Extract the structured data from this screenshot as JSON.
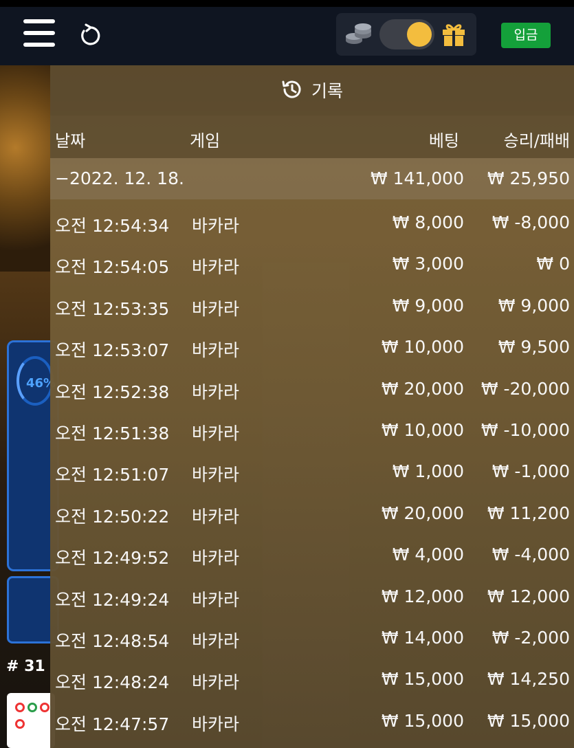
{
  "topbar": {
    "deposit_label": "입금"
  },
  "background": {
    "percent_label": "46%",
    "round_label": "# 31"
  },
  "history": {
    "title": "기록",
    "columns": {
      "date": "날짜",
      "game": "게임",
      "bet": "베팅",
      "result": "승리/패배"
    },
    "day": {
      "date": "−2022. 12. 18.",
      "bet_total": "₩ 141,000",
      "result_total": "₩ 25,950"
    },
    "rows": [
      {
        "time": "오전 12:54:34",
        "game": "바카라",
        "bet": "₩ 8,000",
        "result": "₩ -8,000"
      },
      {
        "time": "오전 12:54:05",
        "game": "바카라",
        "bet": "₩ 3,000",
        "result": "₩ 0"
      },
      {
        "time": "오전 12:53:35",
        "game": "바카라",
        "bet": "₩ 9,000",
        "result": "₩ 9,000"
      },
      {
        "time": "오전 12:53:07",
        "game": "바카라",
        "bet": "₩ 10,000",
        "result": "₩ 9,500"
      },
      {
        "time": "오전 12:52:38",
        "game": "바카라",
        "bet": "₩ 20,000",
        "result": "₩ -20,000"
      },
      {
        "time": "오전 12:51:38",
        "game": "바카라",
        "bet": "₩ 10,000",
        "result": "₩ -10,000"
      },
      {
        "time": "오전 12:51:07",
        "game": "바카라",
        "bet": "₩ 1,000",
        "result": "₩ -1,000"
      },
      {
        "time": "오전 12:50:22",
        "game": "바카라",
        "bet": "₩ 20,000",
        "result": "₩ 11,200"
      },
      {
        "time": "오전 12:49:52",
        "game": "바카라",
        "bet": "₩ 4,000",
        "result": "₩ -4,000"
      },
      {
        "time": "오전 12:49:24",
        "game": "바카라",
        "bet": "₩ 12,000",
        "result": "₩ 12,000"
      },
      {
        "time": "오전 12:48:54",
        "game": "바카라",
        "bet": "₩ 14,000",
        "result": "₩ -2,000"
      },
      {
        "time": "오전 12:48:24",
        "game": "바카라",
        "bet": "₩ 15,000",
        "result": "₩ 14,250"
      },
      {
        "time": "오전 12:47:57",
        "game": "바카라",
        "bet": "₩ 15,000",
        "result": "₩ 15,000"
      }
    ]
  }
}
